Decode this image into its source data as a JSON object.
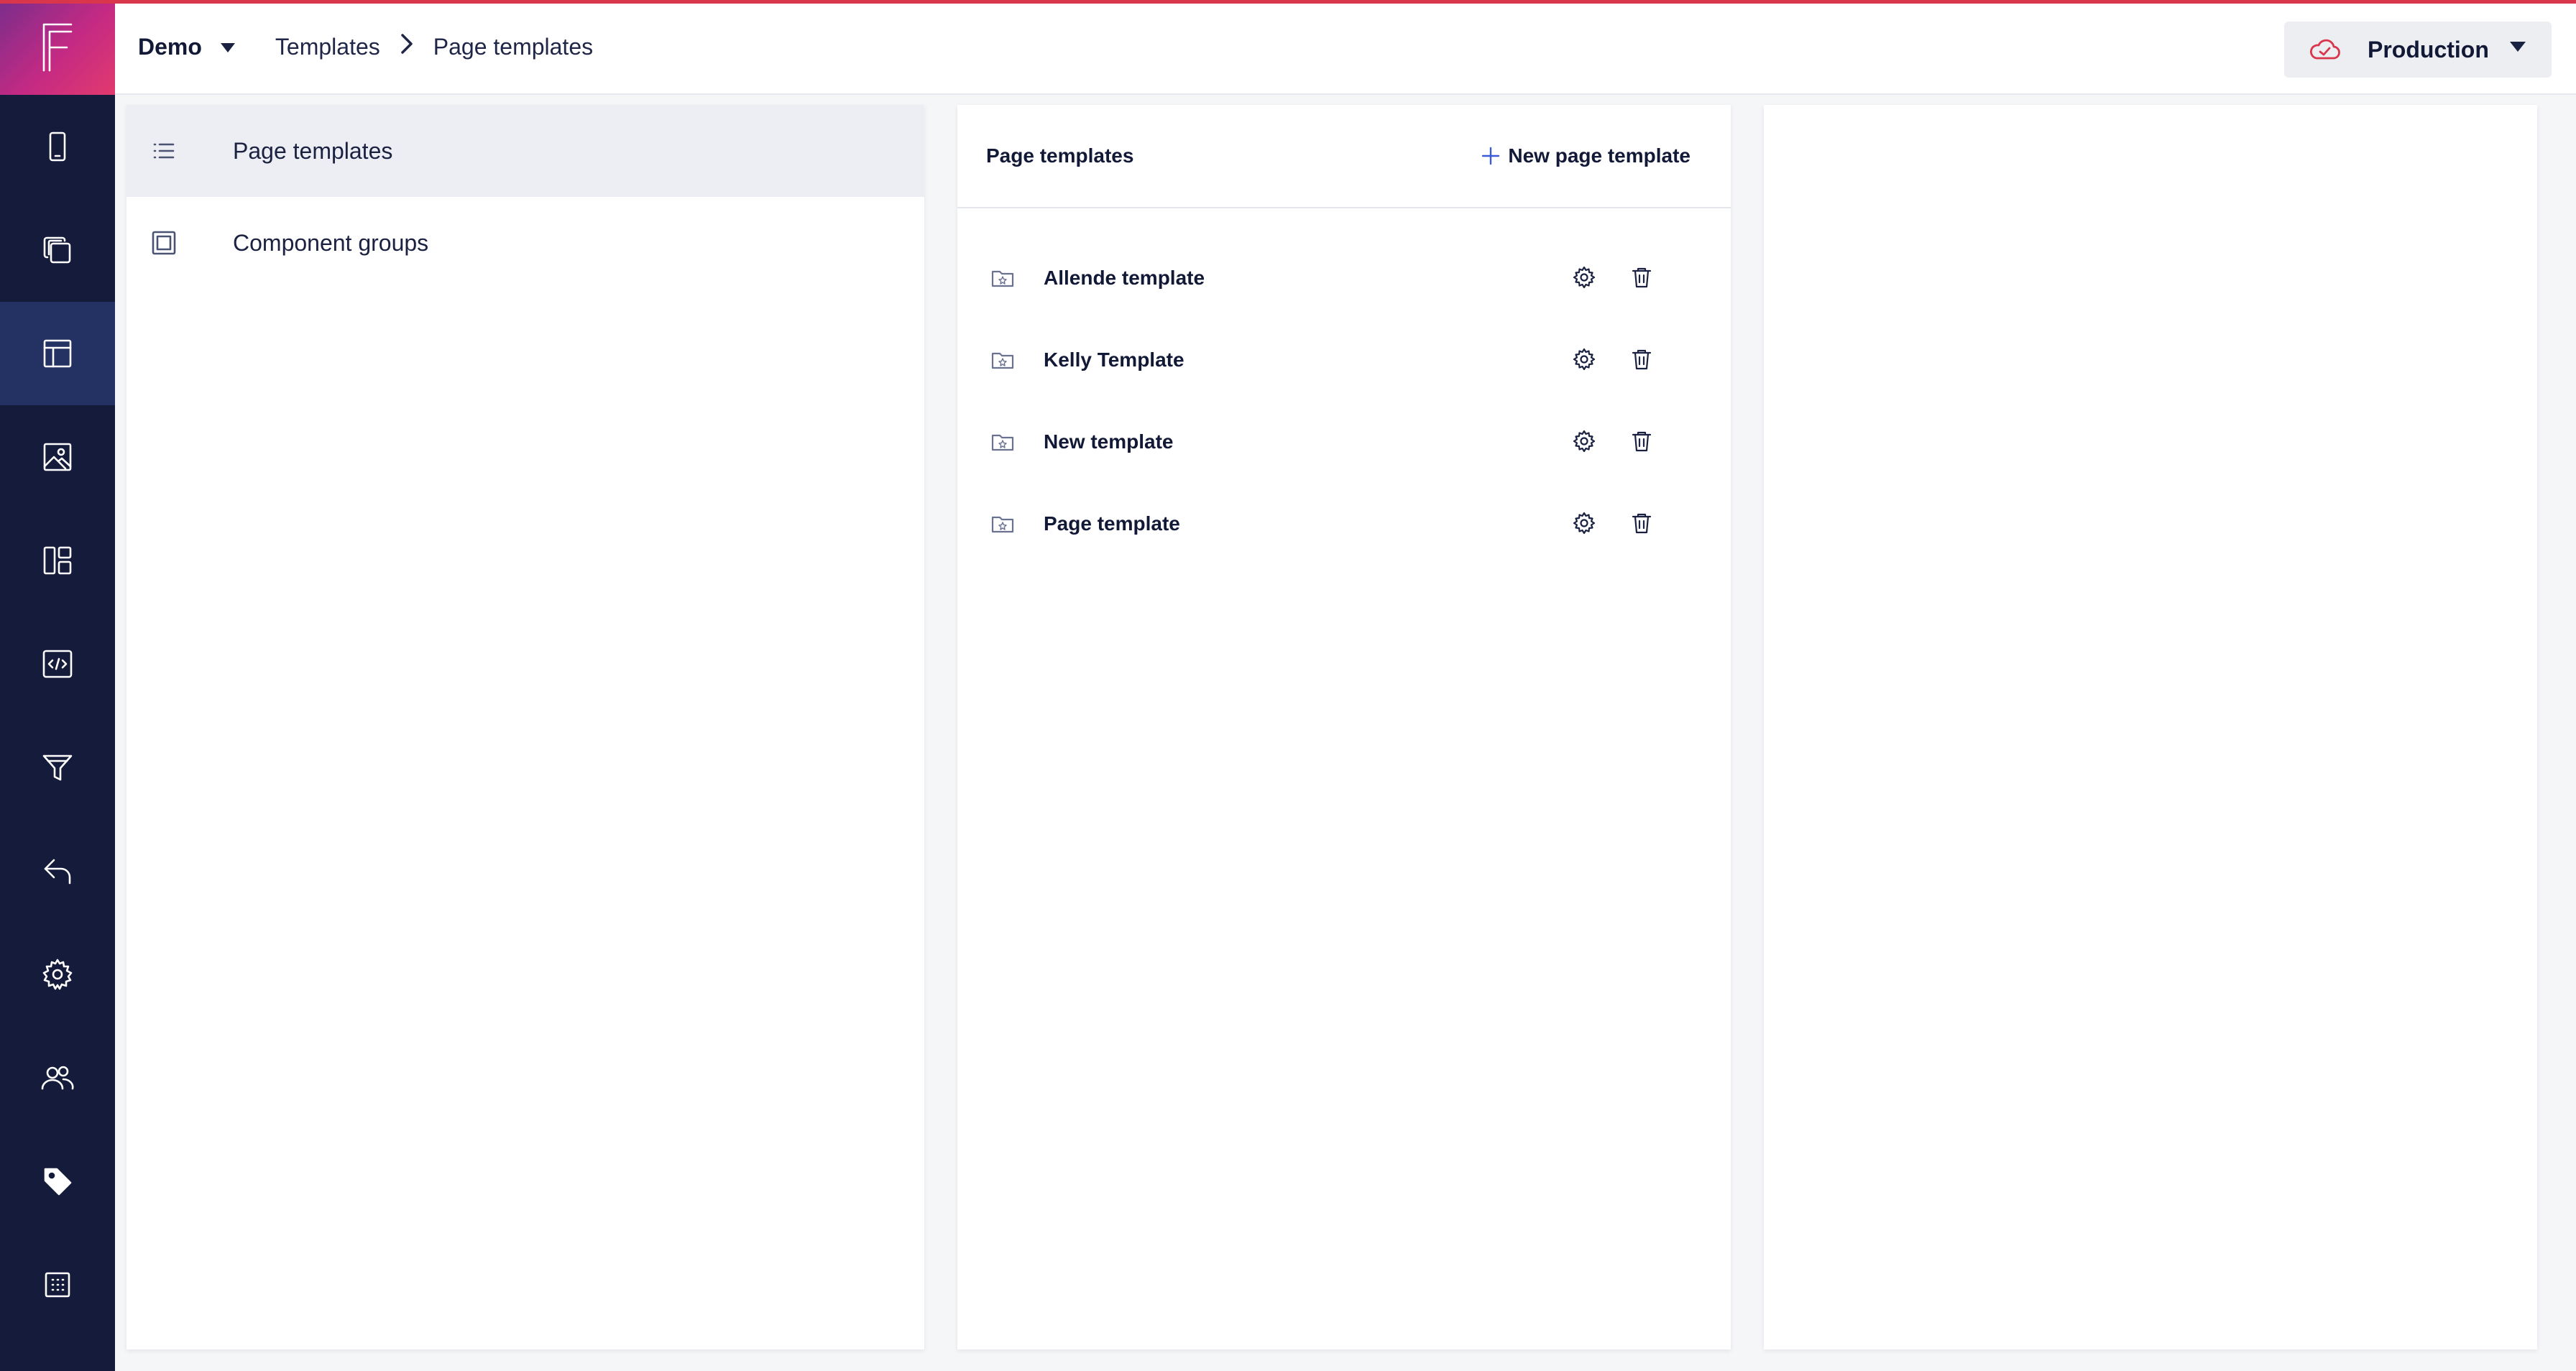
{
  "header": {
    "project": "Demo",
    "breadcrumb": [
      "Templates",
      "Page templates"
    ],
    "environment": "Production",
    "accent_color": "#d9364b"
  },
  "rail": {
    "logo": "F",
    "items": [
      {
        "icon": "mobile-icon"
      },
      {
        "icon": "copy-icon"
      },
      {
        "icon": "layout-icon",
        "active": true
      },
      {
        "icon": "image-icon"
      },
      {
        "icon": "dashboard-icon"
      },
      {
        "icon": "code-icon"
      },
      {
        "icon": "filter-icon"
      },
      {
        "icon": "reply-icon"
      },
      {
        "icon": "gear-icon"
      },
      {
        "icon": "users-icon"
      },
      {
        "icon": "tag-icon"
      },
      {
        "icon": "grid-icon"
      }
    ]
  },
  "nav": {
    "items": [
      {
        "label": "Page templates",
        "icon": "list-icon",
        "active": true
      },
      {
        "label": "Component groups",
        "icon": "square-icon"
      }
    ]
  },
  "templates_panel": {
    "title": "Page templates",
    "new_button": "New page template",
    "items": [
      {
        "name": "Allende template"
      },
      {
        "name": "Kelly Template"
      },
      {
        "name": "New template"
      },
      {
        "name": "Page template"
      }
    ]
  }
}
